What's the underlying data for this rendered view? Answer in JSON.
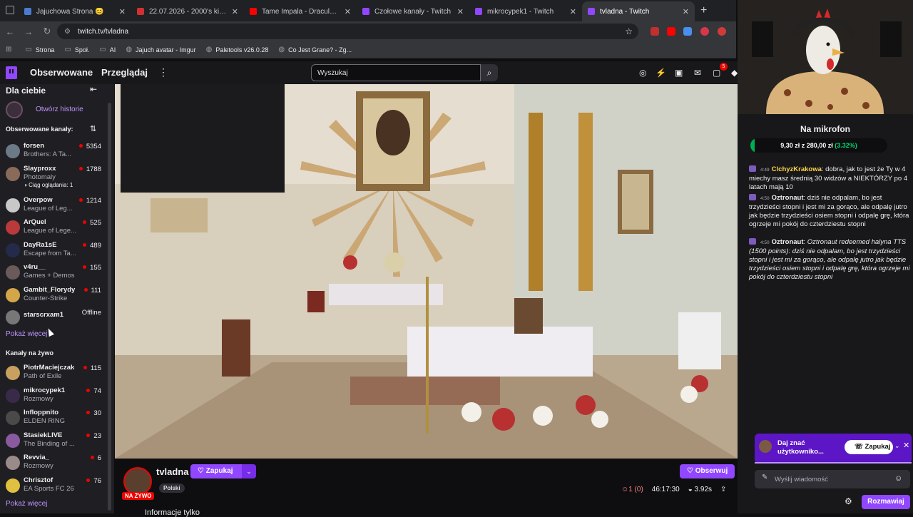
{
  "browser": {
    "tabs": [
      {
        "label": "Jajuchowa Strona 😊",
        "color": "#4a7bd0"
      },
      {
        "label": "22.07.2026 - 2000's kids radio",
        "color": "#d13030"
      },
      {
        "label": "Tame Impala - Dracula (Officia",
        "color": "#ff0000"
      },
      {
        "label": "Czołowe kanały - Twitch",
        "color": "#9147ff"
      },
      {
        "label": "mikrocypek1 - Twitch",
        "color": "#9147ff"
      },
      {
        "label": "tvladna - Twitch",
        "color": "#9147ff"
      }
    ],
    "url": "twitch.tv/tvladna",
    "bookmarks": [
      {
        "label": "Strona",
        "icon": "folder-icon"
      },
      {
        "label": "Społ.",
        "icon": "folder-icon"
      },
      {
        "label": "AI",
        "icon": "folder-icon"
      },
      {
        "label": "Jajuch avatar - Imgur",
        "icon": "globe-icon"
      },
      {
        "label": "Paletools v26.0.28",
        "icon": "globe-icon"
      },
      {
        "label": "Co Jest Grane? - Zg...",
        "icon": "globe-icon"
      }
    ]
  },
  "nav": {
    "following": "Obserwowane",
    "browse": "Przeglądaj",
    "search_placeholder": "Wyszukaj",
    "notification_count": "5"
  },
  "sidebar": {
    "title": "Dla ciebie",
    "history_link": "Otwórz historie",
    "followed_header": "Obserwowane kanały:",
    "followed": [
      {
        "name": "forsen",
        "game": "Brothers: A Ta...",
        "viewers": "5354",
        "color": "#6b7a86"
      },
      {
        "name": "Slayproxx",
        "game": "Photomaly",
        "viewers": "1788",
        "extra": "Ciąg oglądania: 1",
        "color": "#8a6a58"
      },
      {
        "name": "Overpow",
        "game": "League of Leg...",
        "viewers": "1214",
        "color": "#c8c8c8"
      },
      {
        "name": "ArQuel",
        "game": "League of Lege...",
        "viewers": "525",
        "color": "#b83a3a"
      },
      {
        "name": "DayRa1sE",
        "game": "Escape from Ta...",
        "viewers": "489",
        "color": "#242a4a"
      },
      {
        "name": "v4ru__",
        "game": "Games + Demos",
        "viewers": "155",
        "color": "#6a5a5a"
      },
      {
        "name": "Gambit_Florydy",
        "game": "Counter-Strike",
        "viewers": "111",
        "color": "#d4a64a"
      },
      {
        "name": "starscrxam1",
        "game": "",
        "viewers": "Offline",
        "color": "#777777"
      }
    ],
    "show_more_1": "Pokaż więcej",
    "live_header": "Kanały na żywo",
    "live": [
      {
        "name": "PiotrMaciejczak",
        "game": "Path of Exile",
        "viewers": "115",
        "color": "#c8a060"
      },
      {
        "name": "mikrocypek1",
        "game": "Rozmowy",
        "viewers": "74",
        "color": "#3a2a4a"
      },
      {
        "name": "Infloppnito",
        "game": "ELDEN RING",
        "viewers": "30",
        "color": "#4a4a4a"
      },
      {
        "name": "StasiekLIVE",
        "game": "The Binding of ...",
        "viewers": "23",
        "color": "#8a5aa0"
      },
      {
        "name": "Revvia_",
        "game": "Rozmowy",
        "viewers": "6",
        "color": "#9a8a8a"
      },
      {
        "name": "Chrisztof",
        "game": "EA Sports FC 26",
        "viewers": "76",
        "color": "#e0c040"
      }
    ],
    "show_more_2": "Pokaż więcej"
  },
  "stream": {
    "channel": "tvladna",
    "live_badge": "NA ŻYWO",
    "knock_button": "Zapukaj",
    "language_tag": "Polski",
    "follow_button": "Obserwuj",
    "viewers": "1 (0)",
    "uptime": "46:17:30",
    "latency": "3.92s",
    "title_peek": "Informacje tylko"
  },
  "chat": {
    "hype_title": "Na mikrofon",
    "hype_amount": "9,30 zł",
    "hype_sep": " z ",
    "hype_goal": "280,00 zł",
    "hype_pct_label": "(3.32%)",
    "hype_progress": 0.0332,
    "messages": [
      {
        "time": "4:49",
        "user": "ClchyzKrakowa",
        "text": "dobra, jak to jest że Ty w 4 miechy masz średnią 30 widzów a NIEKTÓRZY po 4 latach mają 10",
        "color": "#ffd54a"
      },
      {
        "time": "4:50",
        "user": "Oztronaut",
        "text": "dziś nie odpalam, bo jest trzydzieści stopni i jest mi za gorąco, ale odpalę jutro jak będzie trzydzieści osiem stopni i odpalę grę, która ogrzeje mi pokój do czterdziestu stopni",
        "color": "#efeff1"
      },
      {
        "time": "4:50",
        "user": "Oztronaut",
        "text": "Oztronaut redeemed halyna TTS (1500 points): dziś nie odpalam, bo jest trzydzieści stopni i jest mi za gorąco, ale odpalę jutro jak będzie trzydzieści osiem stopni i odpalę grę, która ogrzeje mi pokój do czterdziestu stopni",
        "color": "#efeff1"
      }
    ],
    "announce_text": "Daj znać użytkowniko...",
    "announce_button": "Zapukaj",
    "input_placeholder": "Wyślij wiadomość",
    "send_button": "Rozmawiaj"
  }
}
